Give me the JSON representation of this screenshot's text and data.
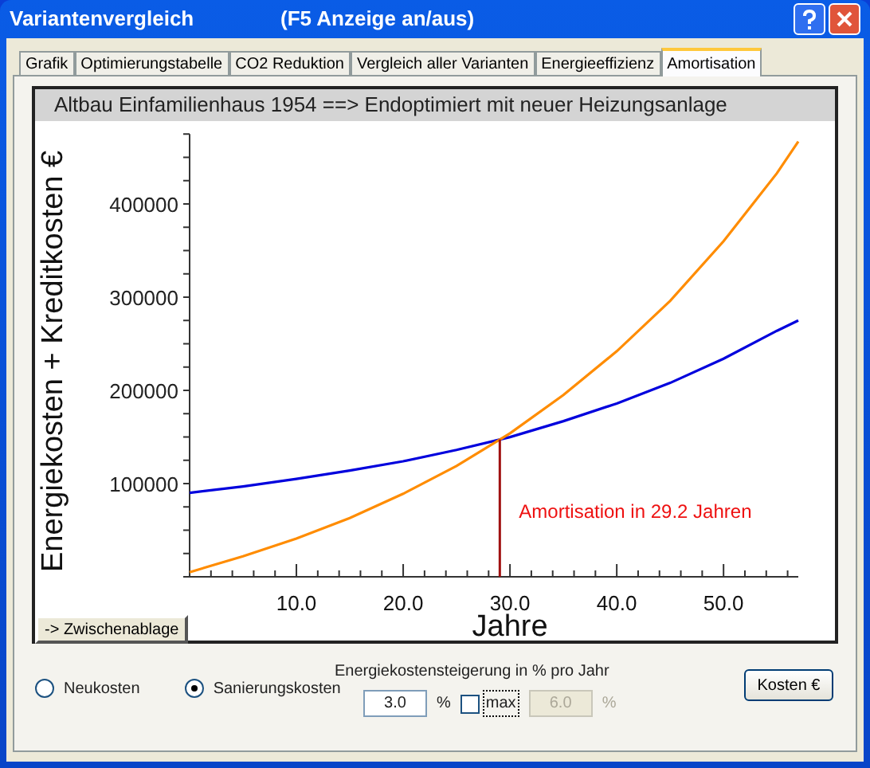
{
  "window": {
    "title": "Variantenvergleich",
    "subtitle": "(F5 Anzeige an/aus)"
  },
  "tabs": [
    {
      "label": "Grafik",
      "selected": false
    },
    {
      "label": "Optimierungstabelle",
      "selected": false
    },
    {
      "label": "CO2 Reduktion",
      "selected": false
    },
    {
      "label": "Vergleich aller Varianten",
      "selected": false
    },
    {
      "label": "Energieeffizienz",
      "selected": false
    },
    {
      "label": "Amortisation",
      "selected": true
    }
  ],
  "chart": {
    "header": "Altbau Einfamilienhaus 1954 ==> Endoptimiert mit neuer Heizungsanlage",
    "chart_data": {
      "type": "line",
      "xlabel": "Jahre",
      "ylabel": "Energiekosten + Kreditkosten €",
      "x": [
        0,
        5,
        10,
        15,
        20,
        25,
        30,
        35,
        40,
        45,
        50,
        55,
        57
      ],
      "series": [
        {
          "color": "#0000dd",
          "values": [
            90000,
            97000,
            105000,
            114000,
            124000,
            136000,
            150000,
            167000,
            186000,
            208000,
            234000,
            264000,
            275000
          ]
        },
        {
          "color": "#ff8c00",
          "values": [
            5000,
            22000,
            41000,
            63000,
            89000,
            119000,
            154000,
            195000,
            242000,
            296000,
            360000,
            433000,
            467000
          ]
        }
      ],
      "xlim": [
        0,
        57
      ],
      "ylim": [
        0,
        475000
      ],
      "xticks": [
        {
          "value": 10,
          "label": "10.0"
        },
        {
          "value": 20,
          "label": "20.0"
        },
        {
          "value": 30,
          "label": "30.0"
        },
        {
          "value": 40,
          "label": "40.0"
        },
        {
          "value": 50,
          "label": "50.0"
        }
      ],
      "yticks": [
        100000,
        200000,
        300000,
        400000
      ],
      "annotations": [
        "Amortisation in 29.2 Jahren"
      ]
    }
  },
  "clipboard_button": "-> Zwischenablage",
  "cost_basis": [
    {
      "label": "Neukosten",
      "selected": false
    },
    {
      "label": "Sanierungskosten",
      "selected": true
    }
  ],
  "increase": {
    "label": "Energiekostensteigerung in % pro Jahr",
    "value": "3.0",
    "unit": "%",
    "max": {
      "label": "max",
      "checked": false
    },
    "max_value": "6.0",
    "max_unit": "%",
    "max_disabled": true
  },
  "costs_button": "Kosten €"
}
